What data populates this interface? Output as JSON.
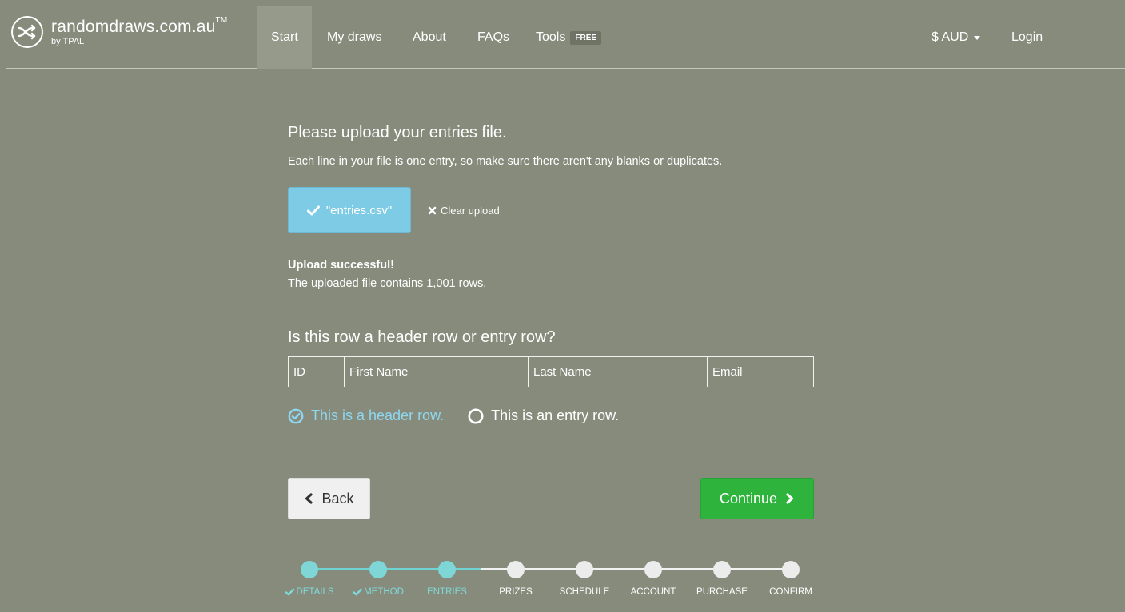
{
  "brand": {
    "name": "randomdraws.com.au",
    "tm": "TM",
    "sub": "by TPAL",
    "logo_icon": "shuffle-icon"
  },
  "nav": {
    "items": [
      {
        "label": "Start",
        "active": true
      },
      {
        "label": "My draws"
      },
      {
        "label": "About"
      },
      {
        "label": "FAQs"
      },
      {
        "label": "Tools",
        "badge": "FREE"
      }
    ],
    "currency": "$ AUD",
    "login": "Login"
  },
  "upload": {
    "heading": "Please upload your entries file.",
    "instructions": "Each line in your file is one entry, so make sure there aren't any blanks or duplicates.",
    "file_label": "\"entries.csv\"",
    "clear_label": "Clear upload",
    "success_title": "Upload successful!",
    "success_text": "The uploaded file contains 1,001 rows."
  },
  "header_check": {
    "question": "Is this row a header row or entry row?",
    "row": [
      "ID",
      "First Name",
      "Last Name",
      "Email"
    ],
    "option_header": "This is a header row.",
    "option_entry": "This is an entry row.",
    "selected": "header"
  },
  "buttons": {
    "back": "Back",
    "continue": "Continue"
  },
  "steps": [
    {
      "label": "DETAILS",
      "done": true,
      "check": true
    },
    {
      "label": "METHOD",
      "done": true,
      "check": true
    },
    {
      "label": "ENTRIES",
      "done": true,
      "check": false
    },
    {
      "label": "PRIZES",
      "done": false
    },
    {
      "label": "SCHEDULE",
      "done": false
    },
    {
      "label": "ACCOUNT",
      "done": false
    },
    {
      "label": "PURCHASE",
      "done": false
    },
    {
      "label": "CONFIRM",
      "done": false
    }
  ],
  "colors": {
    "background": "#878b7c",
    "info_button": "#7ecbe6",
    "continue_button": "#2eb33c",
    "progress_done": "#7ed6d6"
  }
}
